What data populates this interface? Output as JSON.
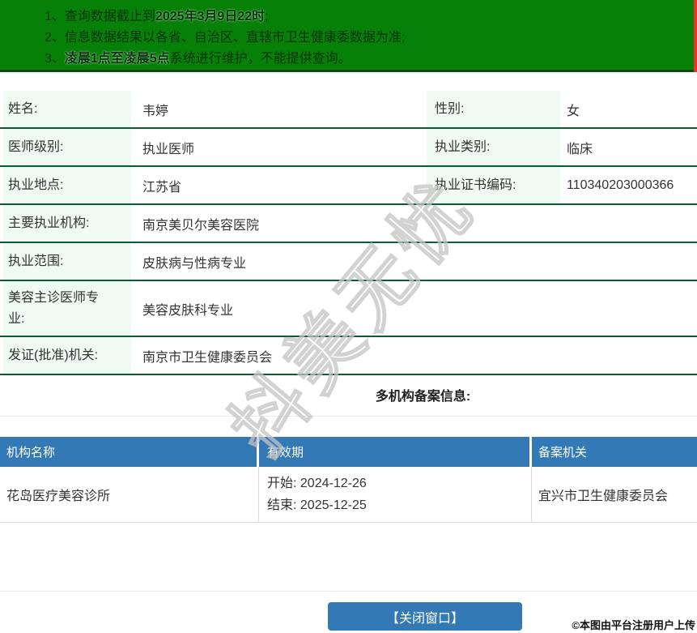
{
  "colors": {
    "banner_green": "#078007",
    "banner_border": "#0a4d0a",
    "red_strip": "#e0392b",
    "table_divider_green": "#0a5c34",
    "label_cell_mint": "#effaf3",
    "header_blue": "#3279b5",
    "watermark_gray": "#c4c4c4"
  },
  "notice_banner": {
    "lines": [
      {
        "num": "1、",
        "pre": "查询数据截止到",
        "bold": "2025年3月9日22时",
        "post": ";"
      },
      {
        "num": "2、",
        "pre": "信息数据结果以各省、自治区、直辖市卫生健康委数据为准;",
        "bold": "",
        "post": ""
      },
      {
        "num": "3、",
        "pre": "",
        "bold": "凌晨1点至凌晨5点",
        "post": "系统进行维护，不能提供查询。"
      }
    ]
  },
  "doctor_info": {
    "row_name_gender": {
      "label1": "姓名:",
      "value1": "韦婷",
      "label2": "性别:",
      "value2": "女"
    },
    "row_level_category": {
      "label1": "医师级别:",
      "value1": "执业医师",
      "label2": "执业类别:",
      "value2": "临床"
    },
    "row_place_license": {
      "label1": "执业地点:",
      "value1": "江苏省",
      "label2": "执业证书编码:",
      "value2": "110340203000366"
    },
    "row_main_org": {
      "label": "主要执业机构:",
      "value": "南京美贝尔美容医院"
    },
    "row_scope": {
      "label": "执业范围:",
      "value": "皮肤病与性病专业"
    },
    "row_cosmetic_specialty": {
      "label": "美容主诊医师专业:",
      "value": "美容皮肤科专业"
    },
    "row_issuing_authority": {
      "label": "发证(批准)机关:",
      "value": "南京市卫生健康委员会"
    }
  },
  "section_heading": "多机构备案信息:",
  "filing_table": {
    "headers": {
      "org": "机构名称",
      "validity": "有效期",
      "authority": "备案机关"
    },
    "row": {
      "org": "花岛医疗美容诊所",
      "valid_start": "开始: 2024-12-26",
      "valid_end": "结束: 2025-12-25",
      "authority": "宜兴市卫生健康委员会"
    }
  },
  "close_button_label": "【关闭窗口】",
  "watermark_text": "抖美无忧",
  "stamp_text": "©本图由平台注册用户上传"
}
